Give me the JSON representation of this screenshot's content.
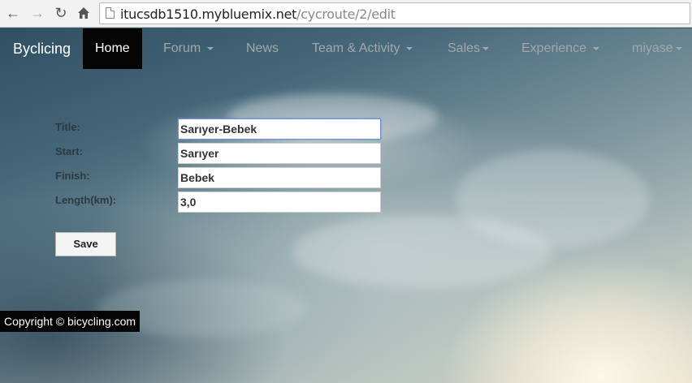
{
  "browser": {
    "url_host": "itucsdb1510.mybluemix.net",
    "url_path": "/cycroute/2/edit",
    "back_icon": "arrow-left",
    "forward_icon": "arrow-right",
    "reload_icon": "reload",
    "home_icon": "home"
  },
  "navbar": {
    "brand": "Byclicing",
    "items": [
      {
        "label": "Home",
        "dropdown": false
      },
      {
        "label": "Forum",
        "dropdown": true
      },
      {
        "label": "News",
        "dropdown": false
      },
      {
        "label": "Team & Activity",
        "dropdown": true
      },
      {
        "label": "Sales",
        "dropdown": true
      },
      {
        "label": "Experience",
        "dropdown": true
      },
      {
        "label": "miyase",
        "dropdown": true
      }
    ]
  },
  "form": {
    "title_label": "Title:",
    "title_value": "Sarıyer-Bebek",
    "start_label": "Start:",
    "start_value": "Sarıyer",
    "finish_label": "Finish:",
    "finish_value": "Bebek",
    "length_label": "Length(km):",
    "length_value": "3,0",
    "save_label": "Save"
  },
  "footer": {
    "text": "Copyright © bicycling.com"
  },
  "colors": {
    "navbar_active": "#050505",
    "nav_text": "#a0a8ad",
    "focus_border": "#6a8fd8"
  }
}
